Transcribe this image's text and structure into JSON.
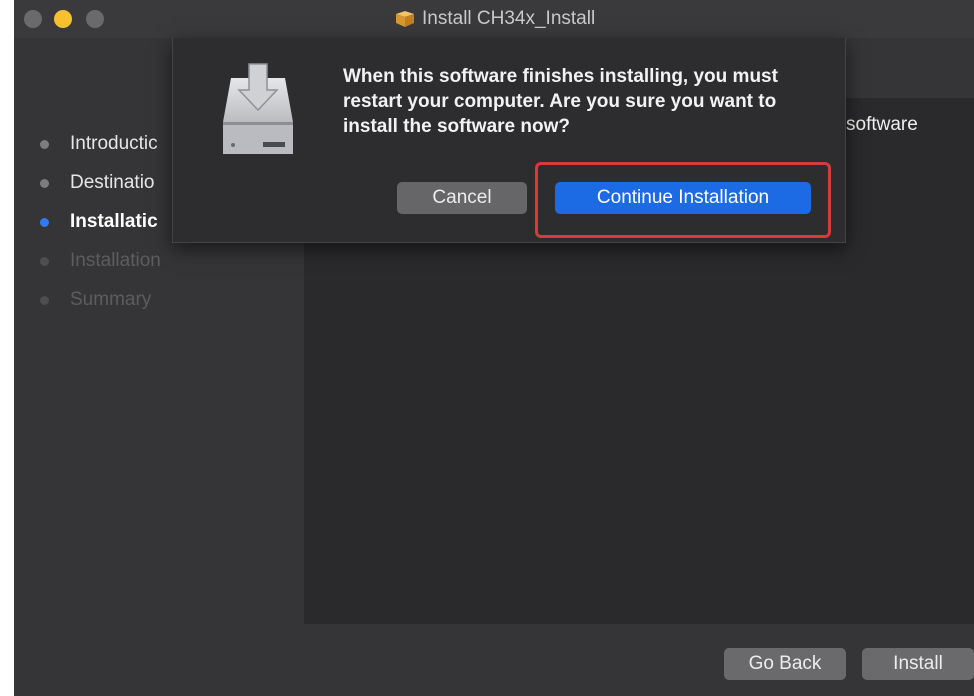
{
  "window": {
    "title": "Install CH34x_Install"
  },
  "sidebar": {
    "steps": [
      {
        "label": "Introductic",
        "state": "done"
      },
      {
        "label": "Destinatio",
        "state": "done"
      },
      {
        "label": "Installatic",
        "state": "current"
      },
      {
        "label": "Installation",
        "state": "future"
      },
      {
        "label": "Summary",
        "state": "future"
      }
    ]
  },
  "content": {
    "partial_text": "software"
  },
  "dialog": {
    "message": "When this software finishes installing, you must restart your computer. Are you sure you want to install the software now?",
    "cancel_label": "Cancel",
    "continue_label": "Continue Installation"
  },
  "footer": {
    "go_back_label": "Go Back",
    "install_label": "Install"
  },
  "icons": {
    "title_icon": "package-icon",
    "dialog_icon": "installer-disk-icon"
  },
  "colors": {
    "accent": "#1d6ae5",
    "highlight": "#d63a3a",
    "current_step_dot": "#2f7bf3"
  }
}
